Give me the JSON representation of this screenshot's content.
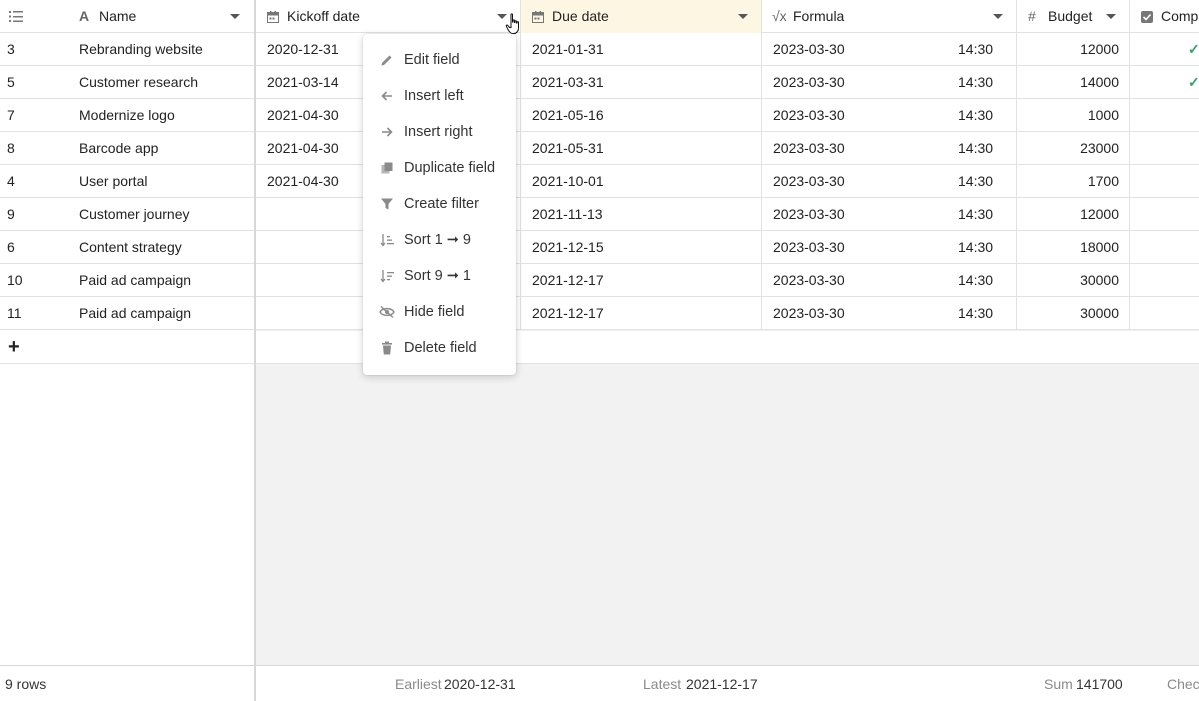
{
  "columns": {
    "index_icon": "numbered-list-icon",
    "name": {
      "icon": "text-icon",
      "label": "Name"
    },
    "kickoff": {
      "icon": "calendar-icon",
      "label": "Kickoff date"
    },
    "due": {
      "icon": "calendar-icon",
      "label": "Due date"
    },
    "formula": {
      "icon": "sqrt-icon",
      "label": "Formula"
    },
    "budget": {
      "icon": "hash-icon",
      "label": "Budget"
    },
    "completed": {
      "icon": "checkbox-icon",
      "label": "Compl"
    }
  },
  "rows": [
    {
      "id": "3",
      "name": "Rebranding website",
      "kickoff": "2020-12-31",
      "due": "2021-01-31",
      "formula_date": "2023-03-30",
      "formula_time": "14:30",
      "budget": "12000",
      "completed": "✓"
    },
    {
      "id": "5",
      "name": "Customer research",
      "kickoff": "2021-03-14",
      "due": "2021-03-31",
      "formula_date": "2023-03-30",
      "formula_time": "14:30",
      "budget": "14000",
      "completed": "✓"
    },
    {
      "id": "7",
      "name": "Modernize logo",
      "kickoff": "2021-04-30",
      "due": "2021-05-16",
      "formula_date": "2023-03-30",
      "formula_time": "14:30",
      "budget": "1000",
      "completed": ""
    },
    {
      "id": "8",
      "name": "Barcode app",
      "kickoff": "2021-04-30",
      "due": "2021-05-31",
      "formula_date": "2023-03-30",
      "formula_time": "14:30",
      "budget": "23000",
      "completed": ""
    },
    {
      "id": "4",
      "name": "User portal",
      "kickoff": "2021-04-30",
      "due": "2021-10-01",
      "formula_date": "2023-03-30",
      "formula_time": "14:30",
      "budget": "1700",
      "completed": ""
    },
    {
      "id": "9",
      "name": "Customer journey",
      "kickoff": "",
      "due": "2021-11-13",
      "formula_date": "2023-03-30",
      "formula_time": "14:30",
      "budget": "12000",
      "completed": ""
    },
    {
      "id": "6",
      "name": "Content strategy",
      "kickoff": "",
      "due": "2021-12-15",
      "formula_date": "2023-03-30",
      "formula_time": "14:30",
      "budget": "18000",
      "completed": ""
    },
    {
      "id": "10",
      "name": "Paid ad campaign",
      "kickoff": "",
      "due": "2021-12-17",
      "formula_date": "2023-03-30",
      "formula_time": "14:30",
      "budget": "30000",
      "completed": ""
    },
    {
      "id": "11",
      "name": "Paid ad campaign",
      "kickoff": "",
      "due": "2021-12-17",
      "formula_date": "2023-03-30",
      "formula_time": "14:30",
      "budget": "30000",
      "completed": ""
    }
  ],
  "add_row_symbol": "+",
  "footer": {
    "row_count": "9 rows",
    "earliest_label": "Earliest",
    "earliest_value": "2020-12-31",
    "latest_label": "Latest",
    "latest_value": "2021-12-17",
    "sum_label": "Sum",
    "sum_value": "141700",
    "checked_label": "Check"
  },
  "context_menu": [
    {
      "icon": "pencil-icon",
      "label": "Edit field"
    },
    {
      "icon": "arrow-left-icon",
      "label": "Insert left"
    },
    {
      "icon": "arrow-right-icon",
      "label": "Insert right"
    },
    {
      "icon": "duplicate-icon",
      "label": "Duplicate field"
    },
    {
      "icon": "filter-icon",
      "label": "Create filter"
    },
    {
      "icon": "sort-ascending-icon",
      "label": "Sort 1 ➞ 9"
    },
    {
      "icon": "sort-descending-icon",
      "label": "Sort 9 ➞ 1"
    },
    {
      "icon": "eye-slash-icon",
      "label": "Hide field"
    },
    {
      "icon": "trash-icon",
      "label": "Delete field"
    }
  ],
  "colors": {
    "highlight_header": "#fdf6e3",
    "check_green": "#2ea36b",
    "border": "#e2e2e2",
    "empty_area": "#f2f2f2"
  }
}
